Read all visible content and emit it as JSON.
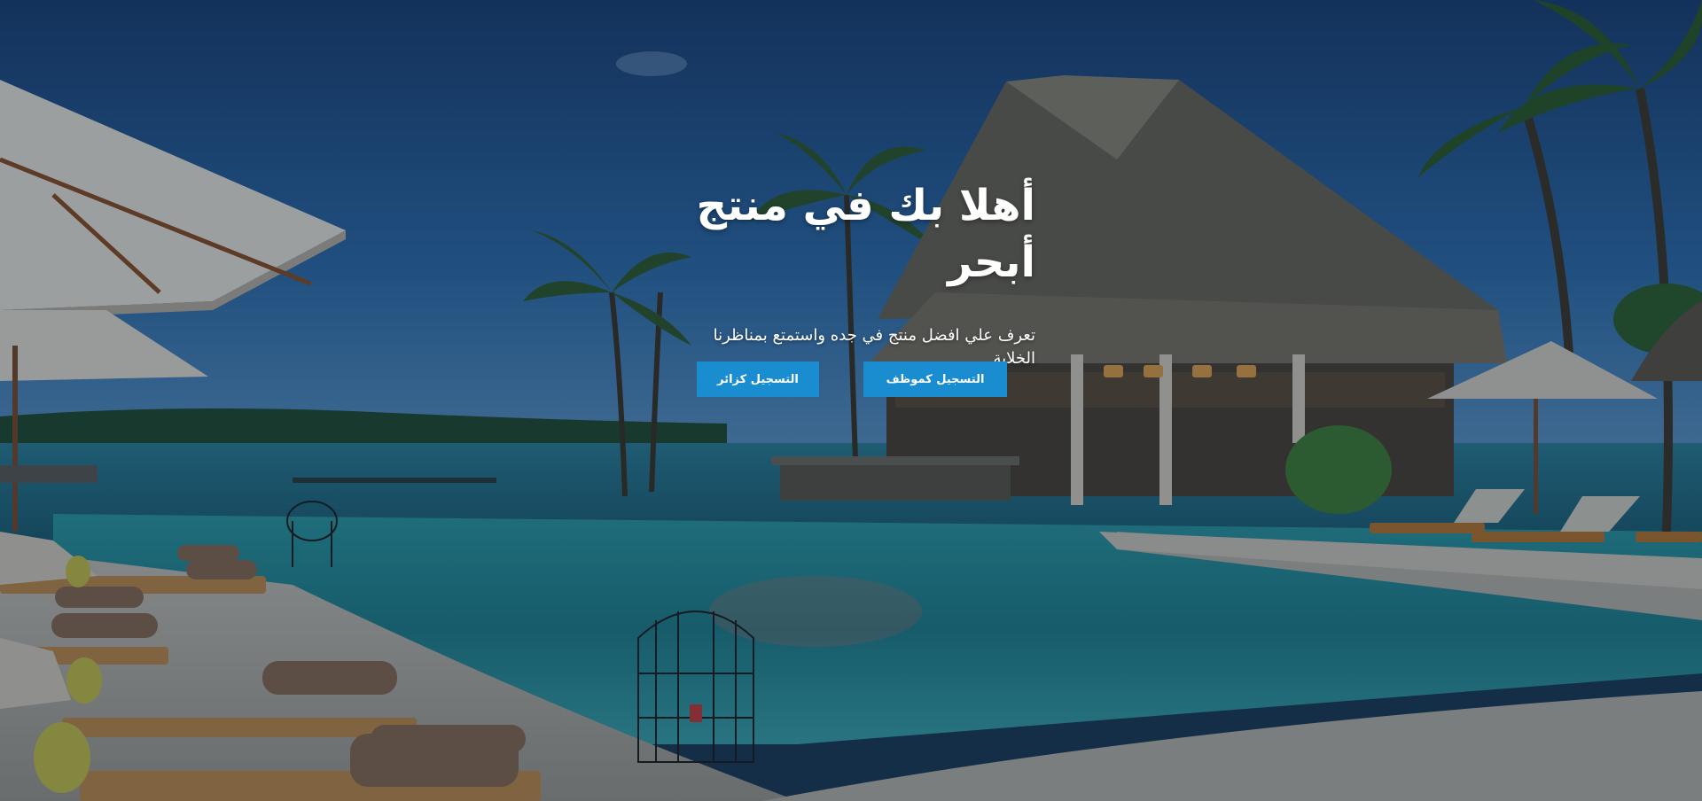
{
  "hero": {
    "title": "أهلا بك في منتج أبحر",
    "subtitle": "تعرف علي افضل منتج في جده واستمتع بمناظرنا الخلابة",
    "buttons": {
      "register_employee": "التسجيل كموظف",
      "register_visitor": "التسجيل كزائر"
    }
  },
  "colors": {
    "button": "#1a8dd1",
    "sky": "#1e4f86",
    "sea": "#2a8c9a",
    "overlay": "rgba(10,25,45,0.35)"
  }
}
